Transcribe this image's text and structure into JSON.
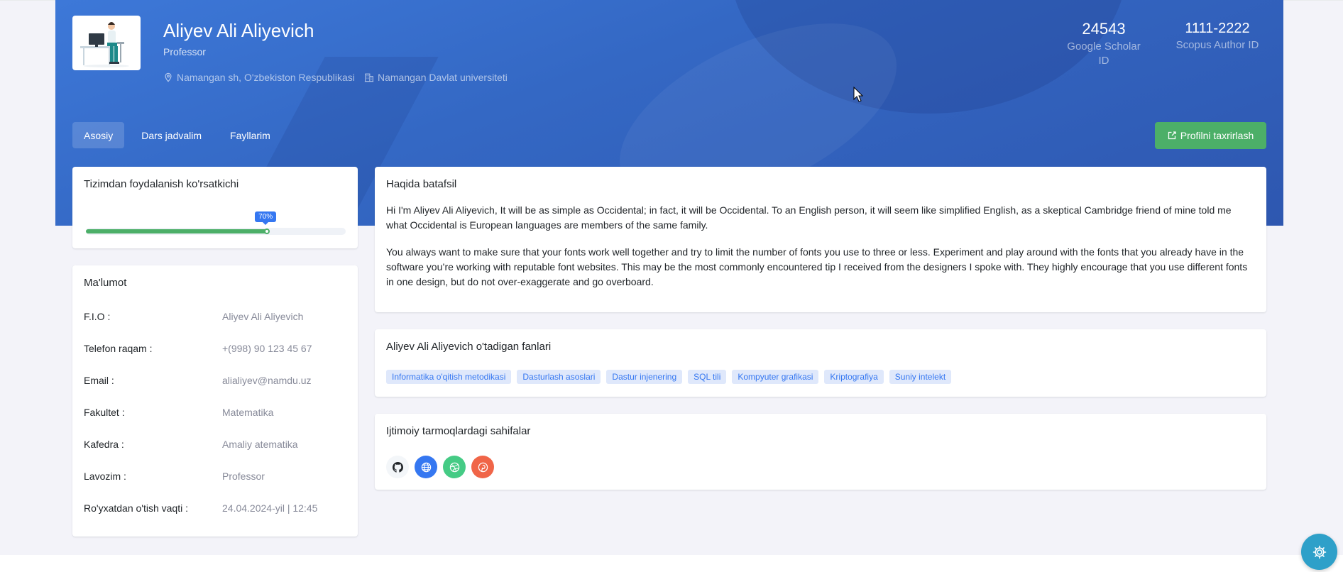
{
  "profile": {
    "name": "Aliyev Ali Aliyevich",
    "role": "Professor",
    "location": "Namangan sh, O'zbekiston Respublikasi",
    "organization": "Namangan Davlat universiteti"
  },
  "stats": [
    {
      "value": "24543",
      "label": "Google Scholar ID"
    },
    {
      "value": "1111-2222",
      "label": "Scopus Author ID"
    }
  ],
  "tabs": [
    "Asosiy",
    "Dars jadvalim",
    "Fayllarim"
  ],
  "active_tab": "Asosiy",
  "edit_button": "Profilni taxrirlash",
  "usage": {
    "title": "Tizimdan foydalanish ko'rsatkichi",
    "percent": 70,
    "label": "70%"
  },
  "info": {
    "title": "Ma'lumot",
    "rows": [
      {
        "key": "F.I.O :",
        "value": "Aliyev Ali Aliyevich"
      },
      {
        "key": "Telefon raqam :",
        "value": "+(998) 90 123 45 67"
      },
      {
        "key": "Email :",
        "value": "alialiyev@namdu.uz"
      },
      {
        "key": "Fakultet :",
        "value": "Matematika"
      },
      {
        "key": "Kafedra :",
        "value": "Amaliy atematika"
      },
      {
        "key": "Lavozim :",
        "value": "Professor"
      },
      {
        "key": "Ro'yxatdan o'tish vaqti :",
        "value": "24.04.2024-yil | 12:45"
      }
    ]
  },
  "about": {
    "title": "Haqida batafsil",
    "p1": "Hi I'm Aliyev Ali Aliyevich, It will be as simple as Occidental; in fact, it will be Occidental. To an English person, it will seem like simplified English, as a skeptical Cambridge friend of mine told me what Occidental is European languages are members of the same family.",
    "p2": "You always want to make sure that your fonts work well together and try to limit the number of fonts you use to three or less. Experiment and play around with the fonts that you already have in the software you’re working with reputable font websites. This may be the most commonly encountered tip I received from the designers I spoke with. They highly encourage that you use different fonts in one design, but do not over-exaggerate and go overboard."
  },
  "subjects": {
    "title": "Aliyev Ali Aliyevich o'tadigan fanlari",
    "items": [
      "Informatika o'qitish metodikasi",
      "Dasturlash asoslari",
      "Dastur injenering",
      "SQL tili",
      "Kompyuter grafikasi",
      "Kriptografiya",
      "Suniy intelekt"
    ]
  },
  "social": {
    "title": "Ijtimoiy tarmoqlardagi sahifalar",
    "items": [
      {
        "icon": "github-icon",
        "bg": "#f3f6f9",
        "fg": "#212529"
      },
      {
        "icon": "globe-icon",
        "bg": "#3577f1",
        "fg": "#ffffff"
      },
      {
        "icon": "dribbble-icon",
        "bg": "#45cb85",
        "fg": "#ffffff"
      },
      {
        "icon": "pinterest-icon",
        "bg": "#f06548",
        "fg": "#ffffff"
      }
    ]
  },
  "colors": {
    "hero": "#3468c4",
    "accent": "#3577f1",
    "success": "#4caf68",
    "fab": "#2ea0c9"
  }
}
